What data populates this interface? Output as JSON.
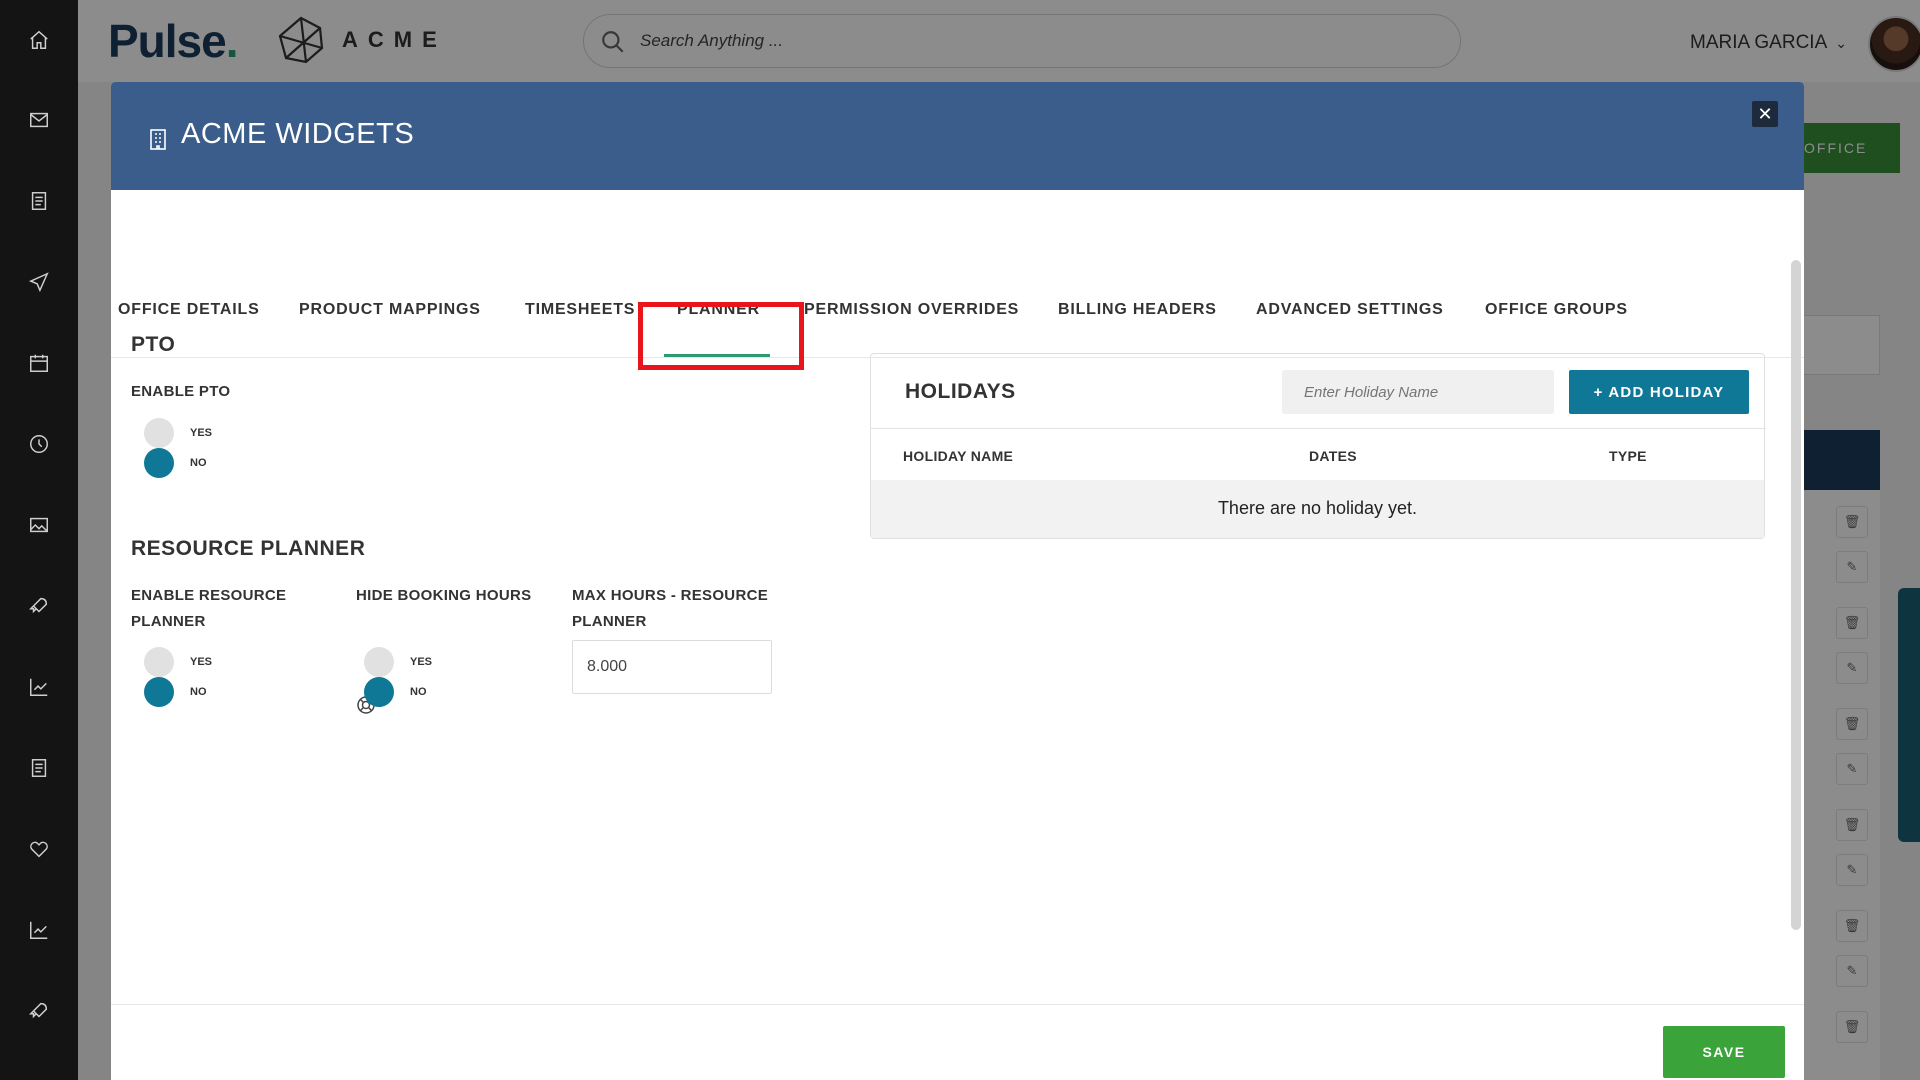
{
  "header": {
    "logo": "Pulse",
    "brand": "ACME",
    "search_placeholder": "Search Anything ...",
    "user_name": "MARIA GARCIA"
  },
  "background": {
    "button_label": "OFFICE"
  },
  "modal": {
    "title": "ACME WIDGETS",
    "tabs": [
      {
        "label": "OFFICE DETAILS"
      },
      {
        "label": "PRODUCT MAPPINGS"
      },
      {
        "label": "TIMESHEETS"
      },
      {
        "label": "PLANNER",
        "active": true
      },
      {
        "label": "PERMISSION OVERRIDES"
      },
      {
        "label": "BILLING HEADERS"
      },
      {
        "label": "ADVANCED SETTINGS"
      },
      {
        "label": "OFFICE GROUPS"
      }
    ],
    "pto": {
      "title": "PTO",
      "enable_label": "ENABLE PTO",
      "yes": "YES",
      "no": "NO",
      "selected": "NO"
    },
    "resource_planner": {
      "title": "RESOURCE PLANNER",
      "enable_label": "ENABLE RESOURCE PLANNER",
      "enable_selected": "NO",
      "hide_label": "HIDE BOOKING HOURS",
      "hide_selected": "NO",
      "max_label": "MAX HOURS - RESOURCE PLANNER",
      "max_value": "8.000",
      "yes": "YES",
      "no": "NO"
    },
    "holidays": {
      "title": "HOLIDAYS",
      "input_placeholder": "Enter Holiday Name",
      "add_button": "+ ADD HOLIDAY",
      "columns": [
        "HOLIDAY NAME",
        "DATES",
        "TYPE"
      ],
      "empty_message": "There are no holiday yet."
    },
    "save_label": "SAVE"
  },
  "colors": {
    "modal_header": "#3b5d8b",
    "accent_teal": "#0f7896",
    "save_green": "#3aa33a",
    "highlight_red": "#e8151b"
  }
}
